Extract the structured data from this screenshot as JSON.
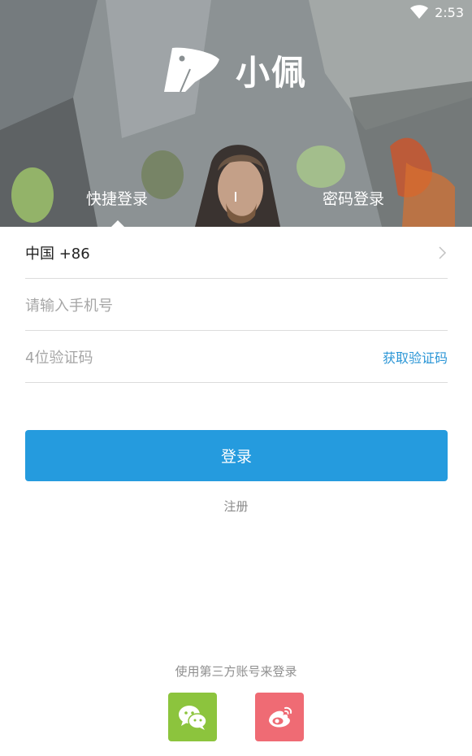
{
  "status_bar": {
    "time": "2:53"
  },
  "brand": {
    "name": "小佩"
  },
  "tabs": {
    "quick_login": "快捷登录",
    "password_login": "密码登录"
  },
  "form": {
    "country": "中国 +86",
    "phone_placeholder": "请输入手机号",
    "code_placeholder": "4位验证码",
    "get_code": "获取验证码"
  },
  "actions": {
    "login": "登录",
    "register": "注册"
  },
  "third_party": {
    "title": "使用第三方账号来登录",
    "icons": [
      "wechat-icon",
      "weibo-icon"
    ]
  },
  "colors": {
    "primary": "#259bde",
    "link": "#2b96d6",
    "wechat": "#8cc43d",
    "weibo": "#ef6b74"
  }
}
